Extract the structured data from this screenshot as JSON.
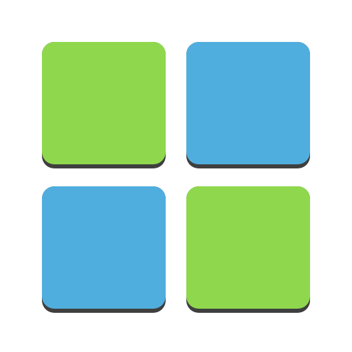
{
  "colors": {
    "green": "#8fd84d",
    "blue": "#50aede",
    "shadow": "#3f3f3f",
    "background": "#ffffff"
  },
  "tiles": [
    {
      "color": "green"
    },
    {
      "color": "blue"
    },
    {
      "color": "blue"
    },
    {
      "color": "green"
    }
  ]
}
